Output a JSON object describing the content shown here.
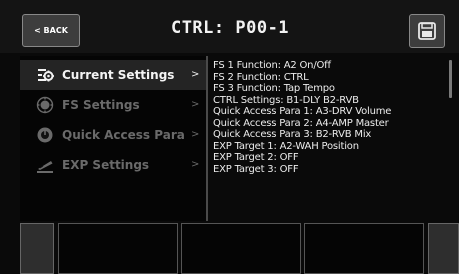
{
  "header": {
    "back_label": "< BACK",
    "title": "CTRL: P00-1",
    "save_icon": "save-icon"
  },
  "menu": {
    "items": [
      {
        "label": "Current Settings",
        "arrow": ">",
        "icon": "settings-cog-icon",
        "active": true
      },
      {
        "label": "FS Settings",
        "arrow": ">",
        "icon": "footswitch-icon",
        "active": false
      },
      {
        "label": "Quick Access Para",
        "arrow": ">",
        "icon": "knob-icon",
        "active": false
      },
      {
        "label": "EXP Settings",
        "arrow": ">",
        "icon": "expression-pedal-icon",
        "active": false
      }
    ]
  },
  "settings": {
    "lines": [
      "FS 1 Function: A2 On/Off",
      "FS 2 Function: CTRL",
      "FS 3 Function: Tap Tempo",
      "CTRL Settings: B1-DLY  B2-RVB",
      "Quick Access Para 1: A3-DRV Volume",
      "Quick Access Para 2: A4-AMP Master",
      "Quick Access Para 3: B2-RVB Mix",
      "EXP Target 1: A2-WAH Position",
      "EXP Target 2: OFF",
      "EXP Target 3: OFF"
    ]
  },
  "colors": {
    "background": "#0a0a0a",
    "active_item": "#242424",
    "inactive_text": "#6a6a6a",
    "button": "#3d3d3d"
  }
}
